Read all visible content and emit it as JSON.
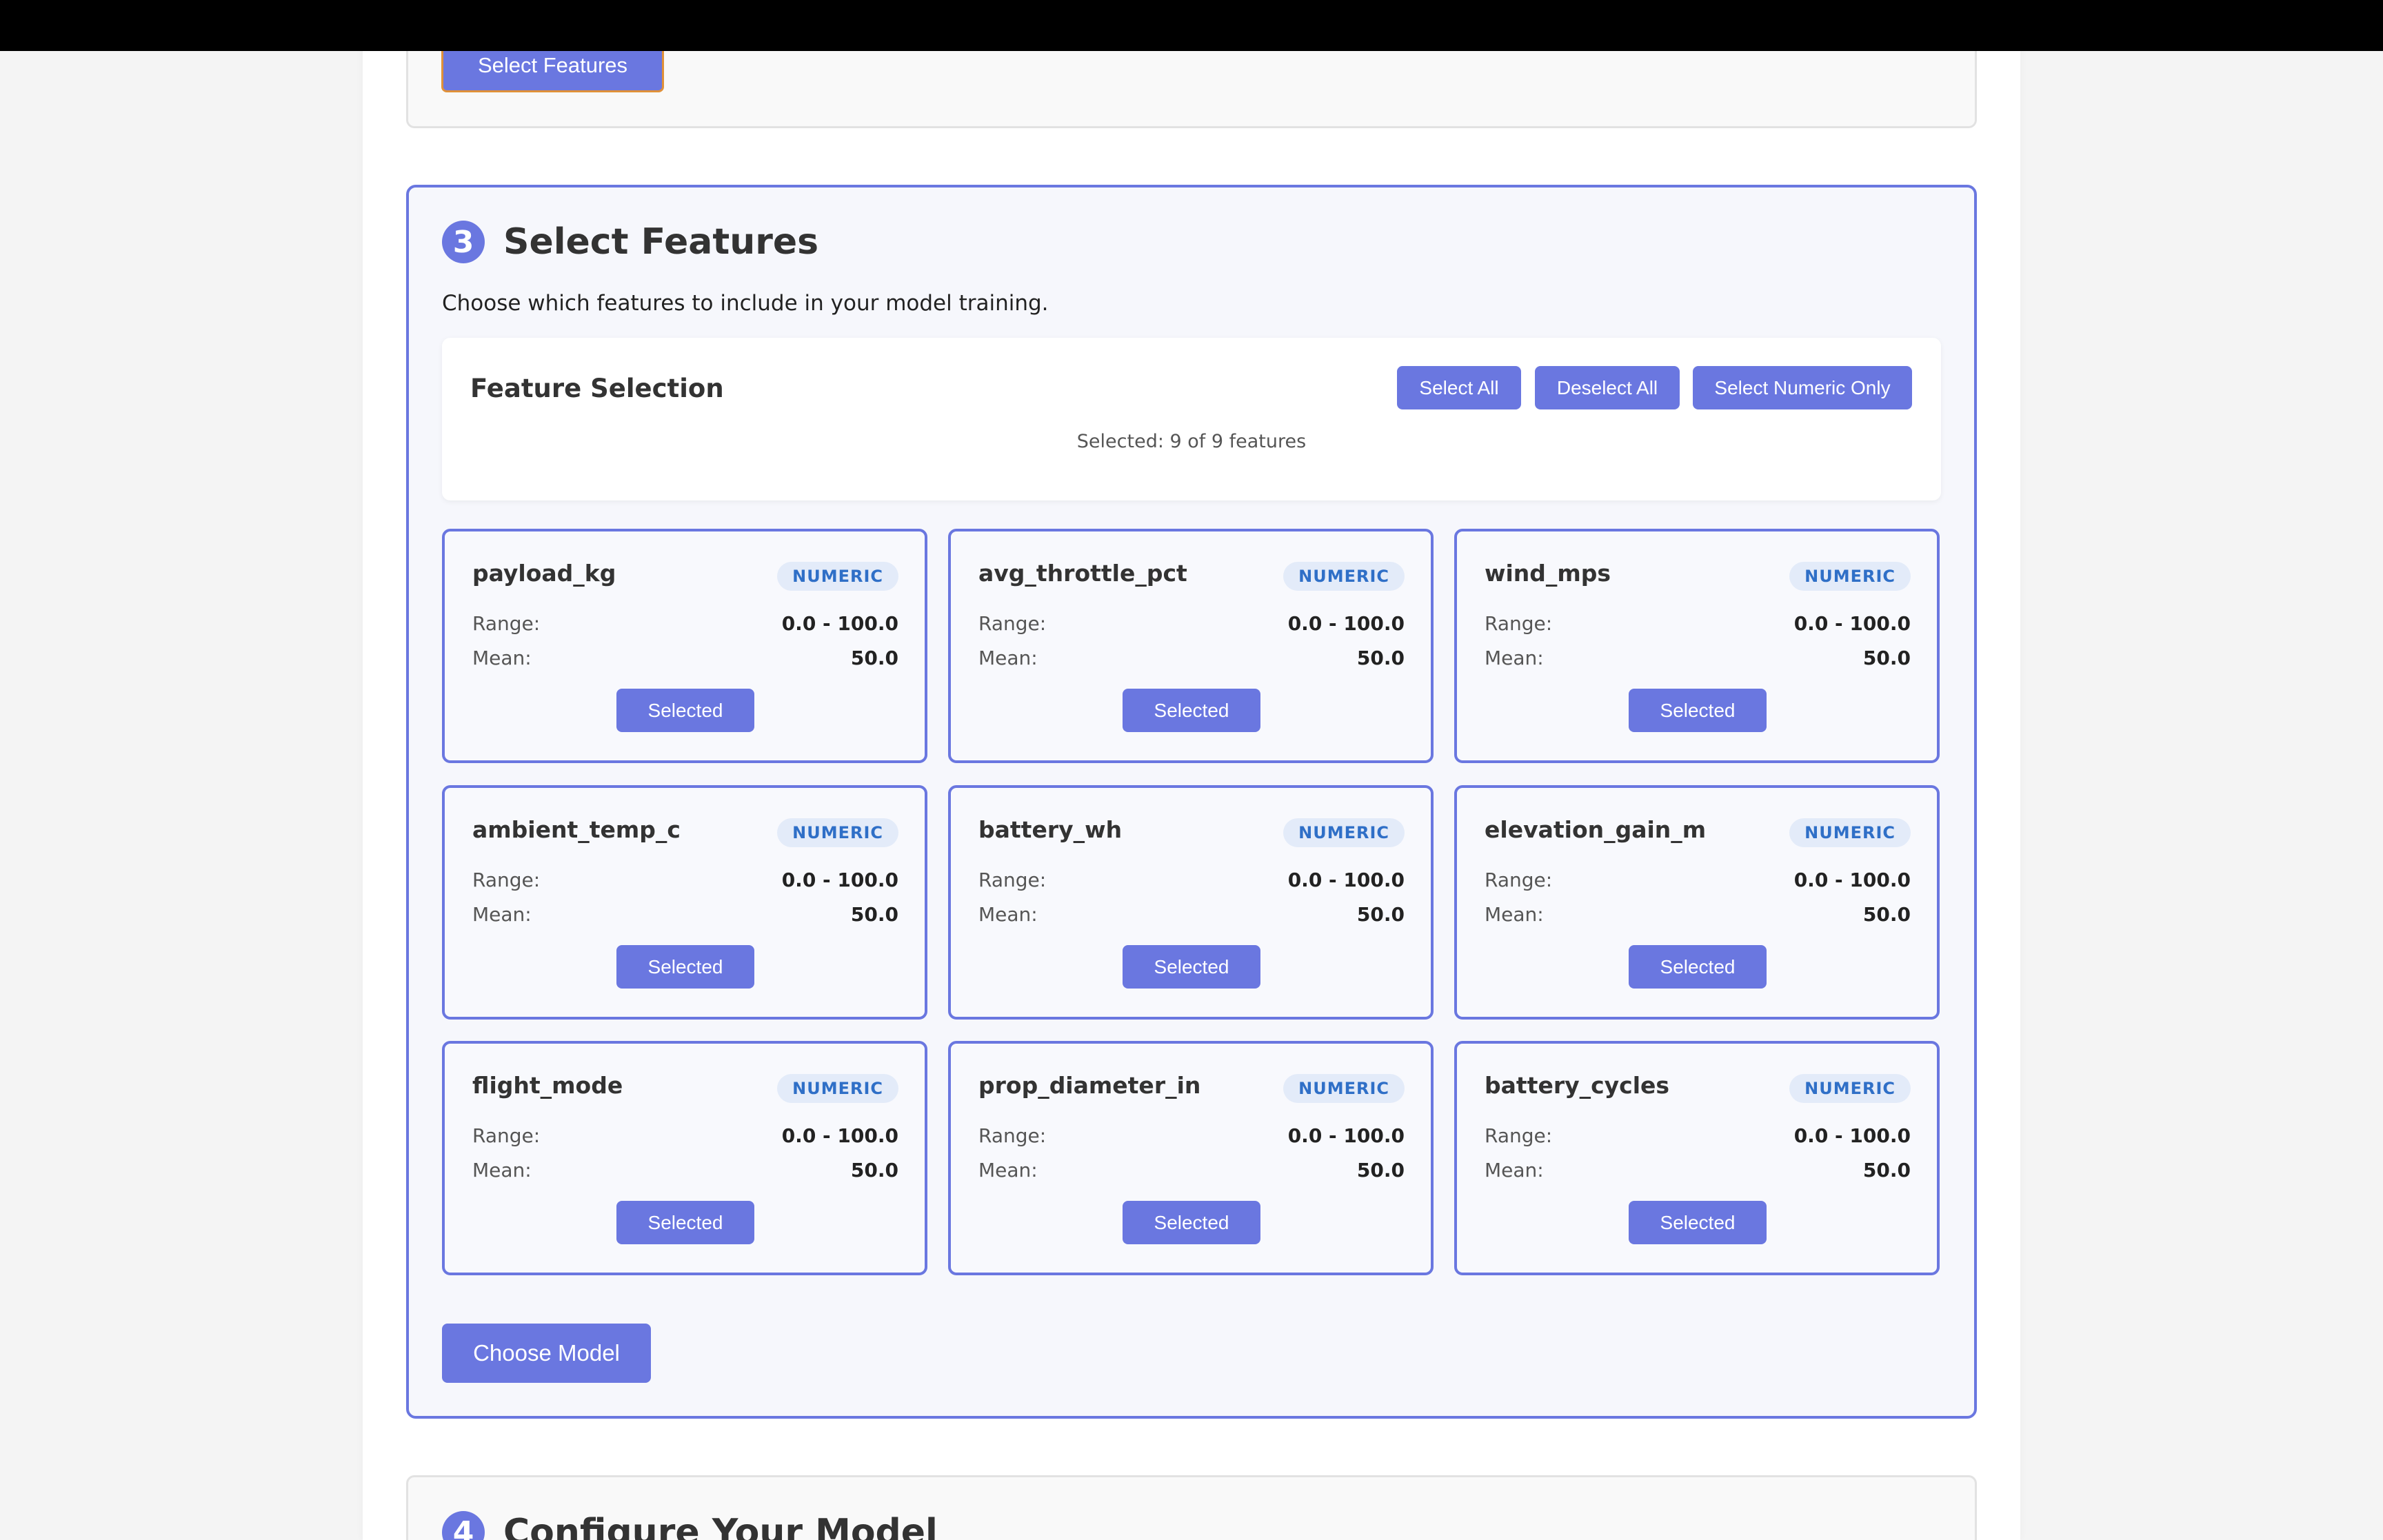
{
  "previous_step": {
    "button_label": "Select Features"
  },
  "step3": {
    "number": "3",
    "title": "Select Features",
    "description": "Choose which features to include in your model training.",
    "feature_selection": {
      "title": "Feature Selection",
      "select_all_label": "Select All",
      "deselect_all_label": "Deselect All",
      "select_numeric_label": "Select Numeric Only",
      "status": "Selected: 9 of 9 features"
    },
    "features": [
      {
        "name": "payload_kg",
        "type": "NUMERIC",
        "range_label": "Range:",
        "range": "0.0 - 100.0",
        "mean_label": "Mean:",
        "mean": "50.0",
        "button": "Selected"
      },
      {
        "name": "avg_throttle_pct",
        "type": "NUMERIC",
        "range_label": "Range:",
        "range": "0.0 - 100.0",
        "mean_label": "Mean:",
        "mean": "50.0",
        "button": "Selected"
      },
      {
        "name": "wind_mps",
        "type": "NUMERIC",
        "range_label": "Range:",
        "range": "0.0 - 100.0",
        "mean_label": "Mean:",
        "mean": "50.0",
        "button": "Selected"
      },
      {
        "name": "ambient_temp_c",
        "type": "NUMERIC",
        "range_label": "Range:",
        "range": "0.0 - 100.0",
        "mean_label": "Mean:",
        "mean": "50.0",
        "button": "Selected"
      },
      {
        "name": "battery_wh",
        "type": "NUMERIC",
        "range_label": "Range:",
        "range": "0.0 - 100.0",
        "mean_label": "Mean:",
        "mean": "50.0",
        "button": "Selected"
      },
      {
        "name": "elevation_gain_m",
        "type": "NUMERIC",
        "range_label": "Range:",
        "range": "0.0 - 100.0",
        "mean_label": "Mean:",
        "mean": "50.0",
        "button": "Selected"
      },
      {
        "name": "flight_mode",
        "type": "NUMERIC",
        "range_label": "Range:",
        "range": "0.0 - 100.0",
        "mean_label": "Mean:",
        "mean": "50.0",
        "button": "Selected"
      },
      {
        "name": "prop_diameter_in",
        "type": "NUMERIC",
        "range_label": "Range:",
        "range": "0.0 - 100.0",
        "mean_label": "Mean:",
        "mean": "50.0",
        "button": "Selected"
      },
      {
        "name": "battery_cycles",
        "type": "NUMERIC",
        "range_label": "Range:",
        "range": "0.0 - 100.0",
        "mean_label": "Mean:",
        "mean": "50.0",
        "button": "Selected"
      }
    ],
    "next_button_label": "Choose Model"
  },
  "step4": {
    "number": "4",
    "title": "Configure Your Model"
  },
  "colors": {
    "accent": "#6a77e0",
    "badge_bg": "#e3ebf9",
    "badge_text": "#2f6fc7",
    "focus_outline": "#e0913a"
  }
}
